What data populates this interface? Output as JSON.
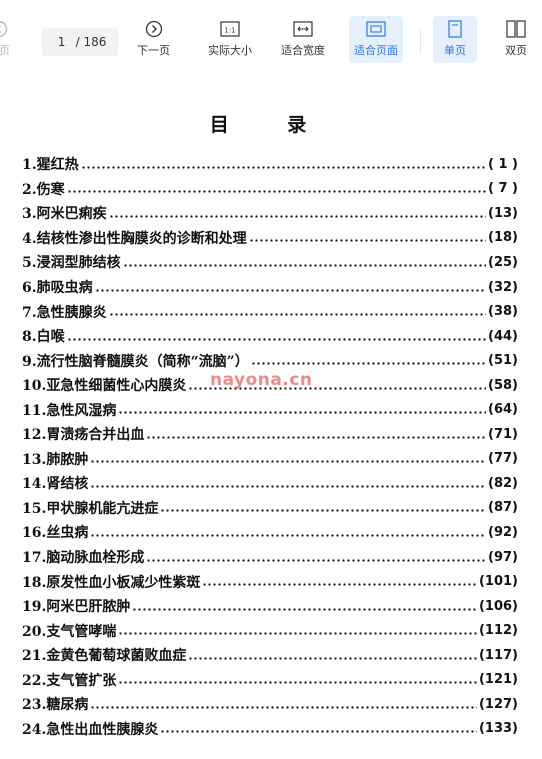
{
  "toolbar": {
    "prev_label": "一页",
    "page_current": "1",
    "page_total": "/ 186",
    "next_label": "下一页",
    "actual_size_label": "实际大小",
    "actual_size_icon_text": "1:1",
    "fit_width_label": "适合宽度",
    "fit_page_label": "适合页面",
    "single_page_label": "单页",
    "double_page_label": "双页"
  },
  "document": {
    "title": "目 录",
    "toc": [
      {
        "title": "1.猩红热",
        "page": "( 1 )"
      },
      {
        "title": "2.伤寒",
        "page": "( 7 )"
      },
      {
        "title": "3.阿米巴痢疾",
        "page": "(13)"
      },
      {
        "title": "4.结核性渗出性胸膜炎的诊断和处理",
        "page": "(18)"
      },
      {
        "title": "5.浸润型肺结核",
        "page": "(25)"
      },
      {
        "title": "6.肺吸虫病",
        "page": "(32)"
      },
      {
        "title": "7.急性胰腺炎",
        "page": "(38)"
      },
      {
        "title": "8.白喉",
        "page": "(44)"
      },
      {
        "title": "9.流行性脑脊髓膜炎（简称“流脑”）",
        "page": "(51)"
      },
      {
        "title": "10.亚急性细菌性心内膜炎",
        "page": "(58)"
      },
      {
        "title": "11.急性风湿病",
        "page": "(64)"
      },
      {
        "title": "12.胃溃疡合并出血",
        "page": "(71)"
      },
      {
        "title": "13.肺脓肿",
        "page": "(77)"
      },
      {
        "title": "14.肾结核",
        "page": "(82)"
      },
      {
        "title": "15.甲状腺机能亢进症",
        "page": "(87)"
      },
      {
        "title": "16.丝虫病",
        "page": "(92)"
      },
      {
        "title": "17.脑动脉血栓形成",
        "page": "(97)"
      },
      {
        "title": "18.原发性血小板减少性紫斑",
        "page": "(101)"
      },
      {
        "title": "19.阿米巴肝脓肿",
        "page": "(106)"
      },
      {
        "title": "20.支气管哮喘",
        "page": "(112)"
      },
      {
        "title": "21.金黄色葡萄球菌败血症",
        "page": "(117)"
      },
      {
        "title": "22.支气管扩张",
        "page": "(121)"
      },
      {
        "title": "23.糖尿病",
        "page": "(127)"
      },
      {
        "title": "24.急性出血性胰腺炎",
        "page": "(133)"
      }
    ],
    "watermark": "nayona.cn"
  },
  "colors": {
    "accent": "#2a78e0",
    "active_bg": "#e6f0fd",
    "watermark": "#e12828"
  }
}
